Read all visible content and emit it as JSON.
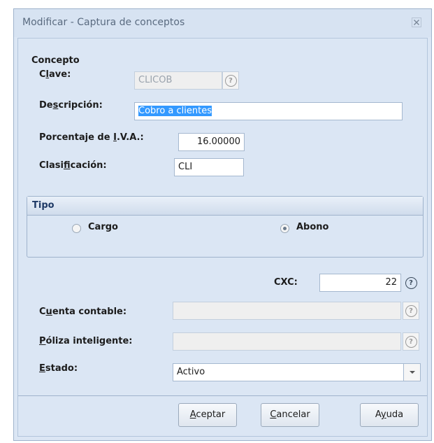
{
  "window": {
    "title": "Modificar - Captura de conceptos",
    "close_glyph": "✕"
  },
  "form": {
    "section_label": "Concepto",
    "clave": {
      "label_pre": "C",
      "label_u": "l",
      "label_post": "ave:",
      "value": "CLICOB"
    },
    "descripcion": {
      "label_pre": "De",
      "label_u": "s",
      "label_post": "cripción:",
      "value": "Cobro a clientes"
    },
    "iva": {
      "label_pre": "Porcentaje de ",
      "label_u": "I",
      "label_post": ".V.A.:",
      "value": "16.00000"
    },
    "clasificacion": {
      "label_pre": "Clasi",
      "label_u": "f",
      "label_post": "icación:",
      "value": "CLI"
    },
    "help_glyph": "?"
  },
  "tipo": {
    "label": "Tipo",
    "options": [
      "Cargo",
      "Abono"
    ],
    "selected": "Abono"
  },
  "cxc": {
    "label": "CXC:",
    "value": "22"
  },
  "cuenta_contable": {
    "label_pre": "C",
    "label_u": "u",
    "label_post": "enta contable:",
    "value": ""
  },
  "poliza": {
    "label_pre": "",
    "label_u": "P",
    "label_post": "óliza inteligente:",
    "value": ""
  },
  "estado": {
    "label_pre": "",
    "label_u": "E",
    "label_post": "stado:",
    "value": "Activo"
  },
  "buttons": {
    "aceptar": {
      "pre": "",
      "u": "A",
      "post": "ceptar"
    },
    "cancelar": {
      "pre": "",
      "u": "C",
      "post": "ancelar"
    },
    "ayuda": {
      "pre": "A",
      "u": "y",
      "post": "uda"
    }
  }
}
